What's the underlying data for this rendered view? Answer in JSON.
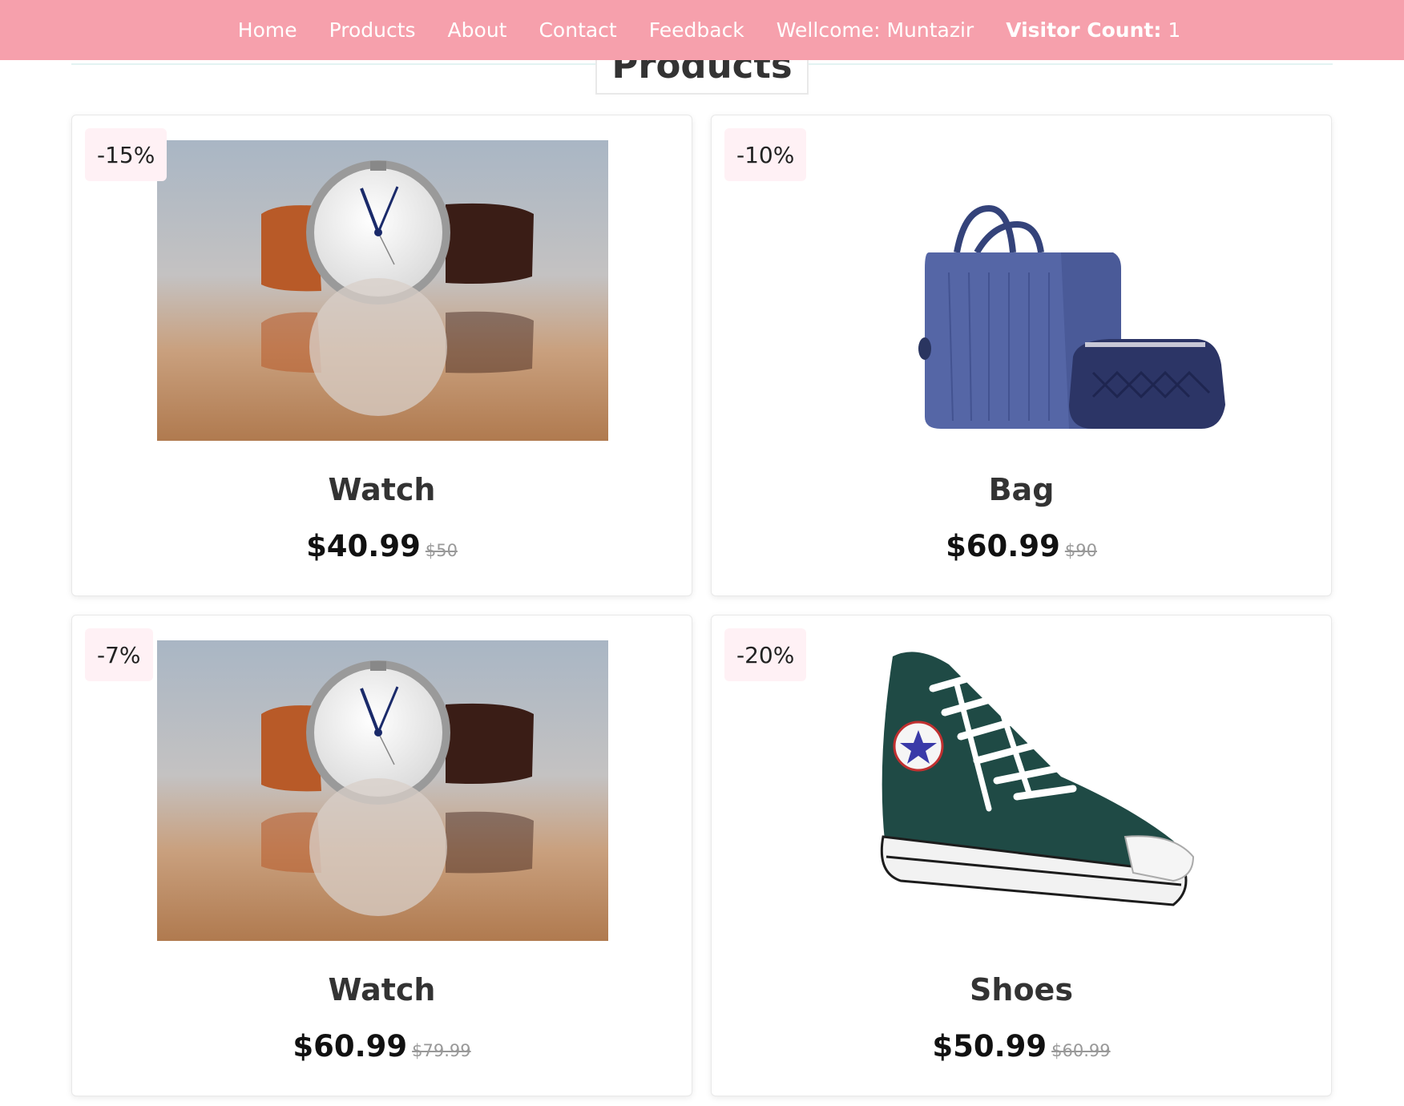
{
  "nav": {
    "items": [
      {
        "label": "Home"
      },
      {
        "label": "Products"
      },
      {
        "label": "About"
      },
      {
        "label": "Contact"
      },
      {
        "label": "Feedback"
      }
    ],
    "welcome": "Wellcome: Muntazir",
    "visitor_label": "Visitor Count:",
    "visitor_count": "1"
  },
  "section": {
    "title": "Products"
  },
  "products": [
    {
      "discount": "-15%",
      "name": "Watch",
      "price": "$40.99",
      "old_price": "$50",
      "image": "watch-image"
    },
    {
      "discount": "-10%",
      "name": "Bag",
      "price": "$60.99",
      "old_price": "$90",
      "image": "bag-image"
    },
    {
      "discount": "-7%",
      "name": "Watch",
      "price": "$60.99",
      "old_price": "$79.99",
      "image": "watch-image"
    },
    {
      "discount": "-20%",
      "name": "Shoes",
      "price": "$50.99",
      "old_price": "$60.99",
      "image": "shoe-image"
    }
  ],
  "colors": {
    "nav_bg": "#f6a0ac",
    "badge_bg": "#fff1f5",
    "heading_line": "#e3f3f2"
  }
}
